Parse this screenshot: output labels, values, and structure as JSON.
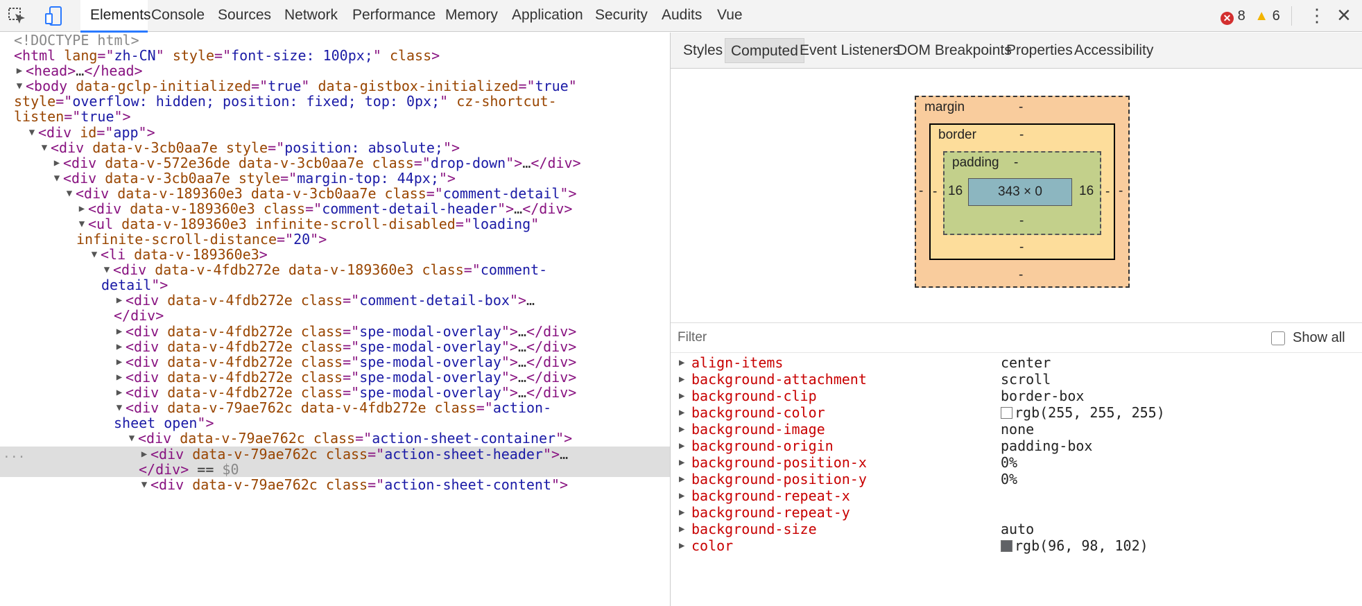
{
  "toolbar": {
    "tabs": [
      "Elements",
      "Console",
      "Sources",
      "Network",
      "Performance",
      "Memory",
      "Application",
      "Security",
      "Audits",
      "Vue"
    ],
    "active_tab": "Elements",
    "error_count": "8",
    "warning_count": "6",
    "icons": [
      "inspect-element-icon",
      "device-toolbar-icon",
      "error-icon",
      "warning-icon",
      "more-options-icon",
      "close-icon"
    ]
  },
  "dom_lines": [
    {
      "tri": "",
      "parts": [
        {
          "c": "c-gray",
          "t": "<!DOCTYPE html>"
        }
      ]
    },
    {
      "tri": "",
      "parts": [
        {
          "c": "c-tag",
          "t": "<html "
        },
        {
          "c": "c-attr",
          "t": "lang"
        },
        {
          "c": "c-tag",
          "t": "=\""
        },
        {
          "c": "c-val",
          "t": "zh-CN"
        },
        {
          "c": "c-tag",
          "t": "\" "
        },
        {
          "c": "c-attr",
          "t": "style"
        },
        {
          "c": "c-tag",
          "t": "=\""
        },
        {
          "c": "c-val",
          "t": "font-size: 100px;"
        },
        {
          "c": "c-tag",
          "t": "\" "
        },
        {
          "c": "c-attr",
          "t": "class"
        },
        {
          "c": "c-tag",
          "t": ">"
        }
      ]
    },
    {
      "tri": "▶",
      "parts": [
        {
          "c": "c-tag",
          "t": "<head>"
        },
        {
          "c": "",
          "t": "…"
        },
        {
          "c": "c-tag",
          "t": "</head>"
        }
      ]
    },
    {
      "tri": "▼",
      "parts": [
        {
          "c": "c-tag",
          "t": "<body "
        },
        {
          "c": "c-attr",
          "t": "data-gclp-initialized"
        },
        {
          "c": "c-tag",
          "t": "=\""
        },
        {
          "c": "c-val",
          "t": "true"
        },
        {
          "c": "c-tag",
          "t": "\" "
        },
        {
          "c": "c-attr",
          "t": "data-gistbox-initialized"
        },
        {
          "c": "c-tag",
          "t": "=\""
        },
        {
          "c": "c-val",
          "t": "true"
        },
        {
          "c": "c-tag",
          "t": "\""
        }
      ]
    },
    {
      "tri": "",
      "parts": [
        {
          "c": "c-attr",
          "t": "style"
        },
        {
          "c": "c-tag",
          "t": "=\""
        },
        {
          "c": "c-val",
          "t": "overflow: hidden; position: fixed; top: 0px;"
        },
        {
          "c": "c-tag",
          "t": "\" "
        },
        {
          "c": "c-attr",
          "t": "cz-shortcut-"
        }
      ]
    },
    {
      "tri": "",
      "parts": [
        {
          "c": "c-attr",
          "t": "listen"
        },
        {
          "c": "c-tag",
          "t": "=\""
        },
        {
          "c": "c-val",
          "t": "true"
        },
        {
          "c": "c-tag",
          "t": "\">"
        }
      ]
    },
    {
      "tri": "▼",
      "parts": [
        {
          "c": "c-tag",
          "t": "<div "
        },
        {
          "c": "c-attr",
          "t": "id"
        },
        {
          "c": "c-tag",
          "t": "=\""
        },
        {
          "c": "c-val",
          "t": "app"
        },
        {
          "c": "c-tag",
          "t": "\">"
        }
      ]
    },
    {
      "tri": "▼",
      "parts": [
        {
          "c": "c-tag",
          "t": "<div "
        },
        {
          "c": "c-attr",
          "t": "data-v-3cb0aa7e "
        },
        {
          "c": "c-attr",
          "t": "style"
        },
        {
          "c": "c-tag",
          "t": "=\""
        },
        {
          "c": "c-val",
          "t": "position: absolute;"
        },
        {
          "c": "c-tag",
          "t": "\">"
        }
      ]
    },
    {
      "tri": "▶",
      "parts": [
        {
          "c": "c-tag",
          "t": "<div "
        },
        {
          "c": "c-attr",
          "t": "data-v-572e36de data-v-3cb0aa7e "
        },
        {
          "c": "c-attr",
          "t": "class"
        },
        {
          "c": "c-tag",
          "t": "=\""
        },
        {
          "c": "c-val",
          "t": "drop-down"
        },
        {
          "c": "c-tag",
          "t": "\">"
        },
        {
          "c": "",
          "t": "…"
        },
        {
          "c": "c-tag",
          "t": "</div>"
        }
      ]
    },
    {
      "tri": "▼",
      "parts": [
        {
          "c": "c-tag",
          "t": "<div "
        },
        {
          "c": "c-attr",
          "t": "data-v-3cb0aa7e "
        },
        {
          "c": "c-attr",
          "t": "style"
        },
        {
          "c": "c-tag",
          "t": "=\""
        },
        {
          "c": "c-val",
          "t": "margin-top: 44px;"
        },
        {
          "c": "c-tag",
          "t": "\">"
        }
      ]
    },
    {
      "tri": "▼",
      "parts": [
        {
          "c": "c-tag",
          "t": "<div "
        },
        {
          "c": "c-attr",
          "t": "data-v-189360e3 data-v-3cb0aa7e "
        },
        {
          "c": "c-attr",
          "t": "class"
        },
        {
          "c": "c-tag",
          "t": "=\""
        },
        {
          "c": "c-val",
          "t": "comment-detail"
        },
        {
          "c": "c-tag",
          "t": "\">"
        }
      ]
    },
    {
      "tri": "▶",
      "parts": [
        {
          "c": "c-tag",
          "t": "<div "
        },
        {
          "c": "c-attr",
          "t": "data-v-189360e3 "
        },
        {
          "c": "c-attr",
          "t": "class"
        },
        {
          "c": "c-tag",
          "t": "=\""
        },
        {
          "c": "c-val",
          "t": "comment-detail-header"
        },
        {
          "c": "c-tag",
          "t": "\">"
        },
        {
          "c": "",
          "t": "…"
        },
        {
          "c": "c-tag",
          "t": "</div>"
        }
      ]
    },
    {
      "tri": "▼",
      "parts": [
        {
          "c": "c-tag",
          "t": "<ul "
        },
        {
          "c": "c-attr",
          "t": "data-v-189360e3 infinite-scroll-disabled"
        },
        {
          "c": "c-tag",
          "t": "=\""
        },
        {
          "c": "c-val",
          "t": "loading"
        },
        {
          "c": "c-tag",
          "t": "\""
        }
      ]
    },
    {
      "tri": "",
      "parts": [
        {
          "c": "c-attr",
          "t": "infinite-scroll-distance"
        },
        {
          "c": "c-tag",
          "t": "=\""
        },
        {
          "c": "c-val",
          "t": "20"
        },
        {
          "c": "c-tag",
          "t": "\">"
        }
      ]
    },
    {
      "tri": "▼",
      "parts": [
        {
          "c": "c-tag",
          "t": "<li "
        },
        {
          "c": "c-attr",
          "t": "data-v-189360e3"
        },
        {
          "c": "c-tag",
          "t": ">"
        }
      ]
    },
    {
      "tri": "▼",
      "parts": [
        {
          "c": "c-tag",
          "t": "<div "
        },
        {
          "c": "c-attr",
          "t": "data-v-4fdb272e data-v-189360e3 "
        },
        {
          "c": "c-attr",
          "t": "class"
        },
        {
          "c": "c-tag",
          "t": "=\""
        },
        {
          "c": "c-val",
          "t": "comment-"
        }
      ]
    },
    {
      "tri": "",
      "parts": [
        {
          "c": "c-val",
          "t": "detail"
        },
        {
          "c": "c-tag",
          "t": "\">"
        }
      ]
    },
    {
      "tri": "▶",
      "parts": [
        {
          "c": "c-tag",
          "t": "<div "
        },
        {
          "c": "c-attr",
          "t": "data-v-4fdb272e "
        },
        {
          "c": "c-attr",
          "t": "class"
        },
        {
          "c": "c-tag",
          "t": "=\""
        },
        {
          "c": "c-val",
          "t": "comment-detail-box"
        },
        {
          "c": "c-tag",
          "t": "\">"
        },
        {
          "c": "",
          "t": "…"
        }
      ]
    },
    {
      "tri": "",
      "parts": [
        {
          "c": "c-tag",
          "t": "</div>"
        }
      ]
    },
    {
      "tri": "▶",
      "parts": [
        {
          "c": "c-tag",
          "t": "<div "
        },
        {
          "c": "c-attr",
          "t": "data-v-4fdb272e "
        },
        {
          "c": "c-attr",
          "t": "class"
        },
        {
          "c": "c-tag",
          "t": "=\""
        },
        {
          "c": "c-val",
          "t": "spe-modal-overlay"
        },
        {
          "c": "c-tag",
          "t": "\">"
        },
        {
          "c": "",
          "t": "…"
        },
        {
          "c": "c-tag",
          "t": "</div>"
        }
      ]
    },
    {
      "tri": "▶",
      "parts": [
        {
          "c": "c-tag",
          "t": "<div "
        },
        {
          "c": "c-attr",
          "t": "data-v-4fdb272e "
        },
        {
          "c": "c-attr",
          "t": "class"
        },
        {
          "c": "c-tag",
          "t": "=\""
        },
        {
          "c": "c-val",
          "t": "spe-modal-overlay"
        },
        {
          "c": "c-tag",
          "t": "\">"
        },
        {
          "c": "",
          "t": "…"
        },
        {
          "c": "c-tag",
          "t": "</div>"
        }
      ]
    },
    {
      "tri": "▶",
      "parts": [
        {
          "c": "c-tag",
          "t": "<div "
        },
        {
          "c": "c-attr",
          "t": "data-v-4fdb272e "
        },
        {
          "c": "c-attr",
          "t": "class"
        },
        {
          "c": "c-tag",
          "t": "=\""
        },
        {
          "c": "c-val",
          "t": "spe-modal-overlay"
        },
        {
          "c": "c-tag",
          "t": "\">"
        },
        {
          "c": "",
          "t": "…"
        },
        {
          "c": "c-tag",
          "t": "</div>"
        }
      ]
    },
    {
      "tri": "▶",
      "parts": [
        {
          "c": "c-tag",
          "t": "<div "
        },
        {
          "c": "c-attr",
          "t": "data-v-4fdb272e "
        },
        {
          "c": "c-attr",
          "t": "class"
        },
        {
          "c": "c-tag",
          "t": "=\""
        },
        {
          "c": "c-val",
          "t": "spe-modal-overlay"
        },
        {
          "c": "c-tag",
          "t": "\">"
        },
        {
          "c": "",
          "t": "…"
        },
        {
          "c": "c-tag",
          "t": "</div>"
        }
      ]
    },
    {
      "tri": "▶",
      "parts": [
        {
          "c": "c-tag",
          "t": "<div "
        },
        {
          "c": "c-attr",
          "t": "data-v-4fdb272e "
        },
        {
          "c": "c-attr",
          "t": "class"
        },
        {
          "c": "c-tag",
          "t": "=\""
        },
        {
          "c": "c-val",
          "t": "spe-modal-overlay"
        },
        {
          "c": "c-tag",
          "t": "\">"
        },
        {
          "c": "",
          "t": "…"
        },
        {
          "c": "c-tag",
          "t": "</div>"
        }
      ]
    },
    {
      "tri": "▼",
      "parts": [
        {
          "c": "c-tag",
          "t": "<div "
        },
        {
          "c": "c-attr",
          "t": "data-v-79ae762c data-v-4fdb272e "
        },
        {
          "c": "c-attr",
          "t": "class"
        },
        {
          "c": "c-tag",
          "t": "=\""
        },
        {
          "c": "c-val",
          "t": "action-"
        }
      ]
    },
    {
      "tri": "",
      "parts": [
        {
          "c": "c-val",
          "t": "sheet open"
        },
        {
          "c": "c-tag",
          "t": "\">"
        }
      ]
    },
    {
      "tri": "▼",
      "parts": [
        {
          "c": "c-tag",
          "t": "<div "
        },
        {
          "c": "c-attr",
          "t": "data-v-79ae762c "
        },
        {
          "c": "c-attr",
          "t": "class"
        },
        {
          "c": "c-tag",
          "t": "=\""
        },
        {
          "c": "c-val",
          "t": "action-sheet-container"
        },
        {
          "c": "c-tag",
          "t": "\">"
        }
      ]
    },
    {
      "tri": "▶",
      "parts": [
        {
          "c": "c-tag",
          "t": "<div "
        },
        {
          "c": "c-attr",
          "t": "data-v-79ae762c "
        },
        {
          "c": "c-attr",
          "t": "class"
        },
        {
          "c": "c-tag",
          "t": "=\""
        },
        {
          "c": "c-val",
          "t": "action-sheet-header"
        },
        {
          "c": "c-tag",
          "t": "\">"
        },
        {
          "c": "",
          "t": "…"
        }
      ]
    },
    {
      "tri": "",
      "parts": [
        {
          "c": "c-tag",
          "t": "</div>"
        },
        {
          "c": "",
          "t": " == "
        },
        {
          "c": "c-gray",
          "t": "$0"
        }
      ]
    },
    {
      "tri": "▼",
      "parts": [
        {
          "c": "c-tag",
          "t": "<div "
        },
        {
          "c": "c-attr",
          "t": "data-v-79ae762c "
        },
        {
          "c": "c-attr",
          "t": "class"
        },
        {
          "c": "c-tag",
          "t": "=\""
        },
        {
          "c": "c-val",
          "t": "action-sheet-content"
        },
        {
          "c": "c-tag",
          "t": "\">"
        }
      ]
    }
  ],
  "selected_marker": "...",
  "right_tabs": [
    "Styles",
    "Computed",
    "Event Listeners",
    "DOM Breakpoints",
    "Properties",
    "Accessibility"
  ],
  "right_active_tab": "Computed",
  "box_model": {
    "margin_label": "margin",
    "margin_top": "-",
    "margin_bottom": "-",
    "margin_left": "-",
    "margin_right": "-",
    "border_label": "border",
    "border_top": "-",
    "border_bottom": "-",
    "border_left": "-",
    "border_right": "-",
    "padding_label": "padding",
    "padding_top": "-",
    "padding_bottom": "-",
    "padding_left": "16",
    "padding_right": "16",
    "content": "343 × 0",
    "colors": {
      "margin": "#f9cc9d",
      "border": "#fddd9b",
      "padding": "#c3d08b",
      "content": "#8cb6c0"
    }
  },
  "filter": {
    "placeholder": "Filter",
    "show_all_label": "Show all"
  },
  "computed_props": [
    {
      "name": "align-items",
      "value": "center"
    },
    {
      "name": "background-attachment",
      "value": "scroll"
    },
    {
      "name": "background-clip",
      "value": "border-box"
    },
    {
      "name": "background-color",
      "value": "rgb(255, 255, 255)",
      "swatch": "#ffffff"
    },
    {
      "name": "background-image",
      "value": "none"
    },
    {
      "name": "background-origin",
      "value": "padding-box"
    },
    {
      "name": "background-position-x",
      "value": "0%"
    },
    {
      "name": "background-position-y",
      "value": "0%"
    },
    {
      "name": "background-repeat-x",
      "value": ""
    },
    {
      "name": "background-repeat-y",
      "value": ""
    },
    {
      "name": "background-size",
      "value": "auto"
    },
    {
      "name": "color",
      "value": "rgb(96, 98, 102)",
      "swatch": "#606266"
    }
  ]
}
